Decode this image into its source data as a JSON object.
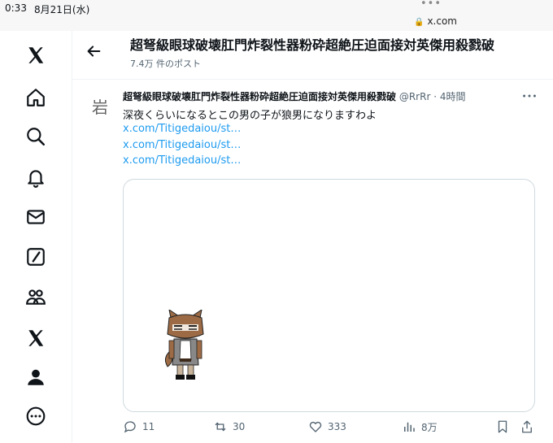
{
  "status_bar": {
    "time": "0:33",
    "date": "8月21日(水)",
    "dots": "•••",
    "url": "x.com"
  },
  "header": {
    "title": "超弩級眼球破壊肛門炸裂性器粉砕超絶圧迫面接対英傑用殺戮破",
    "post_count": "7.4万 件のポスト"
  },
  "post": {
    "avatar_char": "岩",
    "display_name": "超弩級眼球破壊肛門炸裂性器粉砕超絶圧迫面接対英傑用殺戮破",
    "handle": "@RrRr",
    "time": "4時間",
    "text": "深夜くらいになるとこの男の子が狼男になりますわよ",
    "links": [
      "x.com/Titigedaiou/st…",
      "x.com/Titigedaiou/st…",
      "x.com/Titigedaiou/st…"
    ]
  },
  "actions": {
    "reply_count": "11",
    "repost_count": "30",
    "like_count": "333",
    "views_count": "8万"
  },
  "nav_icons": [
    "x-logo-icon",
    "home-icon",
    "search-icon",
    "bell-icon",
    "mail-icon",
    "compose-icon",
    "communities-icon",
    "x-premium-icon",
    "profile-icon",
    "more-circle-icon"
  ],
  "colors": {
    "link": "#1d9bf0",
    "muted": "#536471",
    "text": "#0f1419"
  }
}
